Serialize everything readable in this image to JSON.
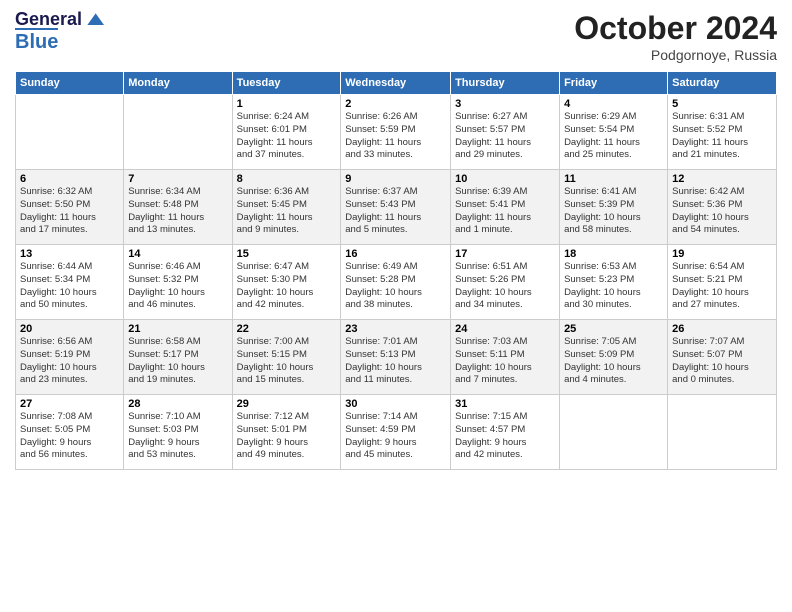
{
  "header": {
    "logo_line1": "General",
    "logo_line2": "Blue",
    "month_title": "October 2024",
    "location": "Podgornoye, Russia"
  },
  "weekdays": [
    "Sunday",
    "Monday",
    "Tuesday",
    "Wednesday",
    "Thursday",
    "Friday",
    "Saturday"
  ],
  "weeks": [
    [
      {
        "day": "",
        "info": ""
      },
      {
        "day": "",
        "info": ""
      },
      {
        "day": "1",
        "info": "Sunrise: 6:24 AM\nSunset: 6:01 PM\nDaylight: 11 hours\nand 37 minutes."
      },
      {
        "day": "2",
        "info": "Sunrise: 6:26 AM\nSunset: 5:59 PM\nDaylight: 11 hours\nand 33 minutes."
      },
      {
        "day": "3",
        "info": "Sunrise: 6:27 AM\nSunset: 5:57 PM\nDaylight: 11 hours\nand 29 minutes."
      },
      {
        "day": "4",
        "info": "Sunrise: 6:29 AM\nSunset: 5:54 PM\nDaylight: 11 hours\nand 25 minutes."
      },
      {
        "day": "5",
        "info": "Sunrise: 6:31 AM\nSunset: 5:52 PM\nDaylight: 11 hours\nand 21 minutes."
      }
    ],
    [
      {
        "day": "6",
        "info": "Sunrise: 6:32 AM\nSunset: 5:50 PM\nDaylight: 11 hours\nand 17 minutes."
      },
      {
        "day": "7",
        "info": "Sunrise: 6:34 AM\nSunset: 5:48 PM\nDaylight: 11 hours\nand 13 minutes."
      },
      {
        "day": "8",
        "info": "Sunrise: 6:36 AM\nSunset: 5:45 PM\nDaylight: 11 hours\nand 9 minutes."
      },
      {
        "day": "9",
        "info": "Sunrise: 6:37 AM\nSunset: 5:43 PM\nDaylight: 11 hours\nand 5 minutes."
      },
      {
        "day": "10",
        "info": "Sunrise: 6:39 AM\nSunset: 5:41 PM\nDaylight: 11 hours\nand 1 minute."
      },
      {
        "day": "11",
        "info": "Sunrise: 6:41 AM\nSunset: 5:39 PM\nDaylight: 10 hours\nand 58 minutes."
      },
      {
        "day": "12",
        "info": "Sunrise: 6:42 AM\nSunset: 5:36 PM\nDaylight: 10 hours\nand 54 minutes."
      }
    ],
    [
      {
        "day": "13",
        "info": "Sunrise: 6:44 AM\nSunset: 5:34 PM\nDaylight: 10 hours\nand 50 minutes."
      },
      {
        "day": "14",
        "info": "Sunrise: 6:46 AM\nSunset: 5:32 PM\nDaylight: 10 hours\nand 46 minutes."
      },
      {
        "day": "15",
        "info": "Sunrise: 6:47 AM\nSunset: 5:30 PM\nDaylight: 10 hours\nand 42 minutes."
      },
      {
        "day": "16",
        "info": "Sunrise: 6:49 AM\nSunset: 5:28 PM\nDaylight: 10 hours\nand 38 minutes."
      },
      {
        "day": "17",
        "info": "Sunrise: 6:51 AM\nSunset: 5:26 PM\nDaylight: 10 hours\nand 34 minutes."
      },
      {
        "day": "18",
        "info": "Sunrise: 6:53 AM\nSunset: 5:23 PM\nDaylight: 10 hours\nand 30 minutes."
      },
      {
        "day": "19",
        "info": "Sunrise: 6:54 AM\nSunset: 5:21 PM\nDaylight: 10 hours\nand 27 minutes."
      }
    ],
    [
      {
        "day": "20",
        "info": "Sunrise: 6:56 AM\nSunset: 5:19 PM\nDaylight: 10 hours\nand 23 minutes."
      },
      {
        "day": "21",
        "info": "Sunrise: 6:58 AM\nSunset: 5:17 PM\nDaylight: 10 hours\nand 19 minutes."
      },
      {
        "day": "22",
        "info": "Sunrise: 7:00 AM\nSunset: 5:15 PM\nDaylight: 10 hours\nand 15 minutes."
      },
      {
        "day": "23",
        "info": "Sunrise: 7:01 AM\nSunset: 5:13 PM\nDaylight: 10 hours\nand 11 minutes."
      },
      {
        "day": "24",
        "info": "Sunrise: 7:03 AM\nSunset: 5:11 PM\nDaylight: 10 hours\nand 7 minutes."
      },
      {
        "day": "25",
        "info": "Sunrise: 7:05 AM\nSunset: 5:09 PM\nDaylight: 10 hours\nand 4 minutes."
      },
      {
        "day": "26",
        "info": "Sunrise: 7:07 AM\nSunset: 5:07 PM\nDaylight: 10 hours\nand 0 minutes."
      }
    ],
    [
      {
        "day": "27",
        "info": "Sunrise: 7:08 AM\nSunset: 5:05 PM\nDaylight: 9 hours\nand 56 minutes."
      },
      {
        "day": "28",
        "info": "Sunrise: 7:10 AM\nSunset: 5:03 PM\nDaylight: 9 hours\nand 53 minutes."
      },
      {
        "day": "29",
        "info": "Sunrise: 7:12 AM\nSunset: 5:01 PM\nDaylight: 9 hours\nand 49 minutes."
      },
      {
        "day": "30",
        "info": "Sunrise: 7:14 AM\nSunset: 4:59 PM\nDaylight: 9 hours\nand 45 minutes."
      },
      {
        "day": "31",
        "info": "Sunrise: 7:15 AM\nSunset: 4:57 PM\nDaylight: 9 hours\nand 42 minutes."
      },
      {
        "day": "",
        "info": ""
      },
      {
        "day": "",
        "info": ""
      }
    ]
  ]
}
